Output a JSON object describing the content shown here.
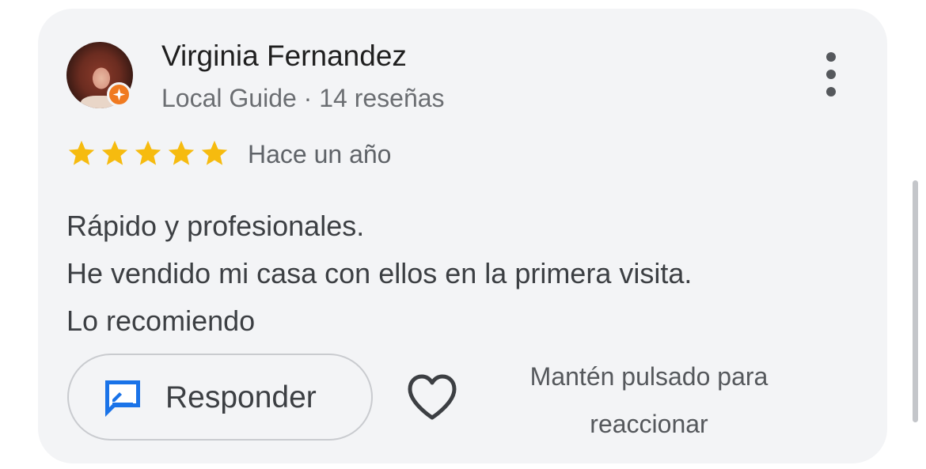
{
  "review": {
    "author_name": "Virginia Fernandez",
    "author_meta": "Local Guide · 14 reseñas",
    "rating": 5,
    "rating_max": 5,
    "time_ago": "Hace un año",
    "text_lines": [
      "Rápido y profesionales.",
      "He vendido mi casa con ellos en la primera visita.",
      "Lo recomiendo"
    ]
  },
  "actions": {
    "reply_label": "Responder",
    "hint_line1": "Mantén pulsado para",
    "hint_line2": "reaccionar"
  },
  "icons": {
    "more": "more-vertical-icon",
    "star": "star-icon",
    "reply": "reply-icon",
    "heart": "heart-outline-icon",
    "guide": "local-guide-badge-icon"
  },
  "colors": {
    "star": "#f6bb0f",
    "reply_icon": "#1a73e8",
    "guide_badge": "#f07a20",
    "card_bg": "#f3f4f6"
  }
}
